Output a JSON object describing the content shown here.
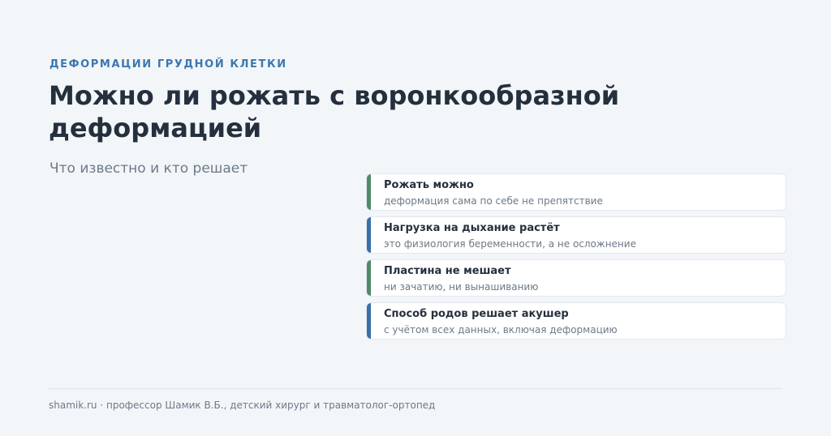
{
  "header": {
    "eyebrow": "ДЕФОРМАЦИИ ГРУДНОЙ КЛЕТКИ",
    "title": "Можно ли рожать с воронкообразной деформацией",
    "subtitle": "Что известно и кто решает"
  },
  "cards": [
    {
      "title": "Рожать можно",
      "subtitle": "деформация сама по себе не препятствие",
      "accent": "#4f8a68"
    },
    {
      "title": "Нагрузка на дыхание растёт",
      "subtitle": "это физиология беременности, а не осложнение",
      "accent": "#3a6fa8"
    },
    {
      "title": "Пластина не мешает",
      "subtitle": "ни зачатию, ни вынашиванию",
      "accent": "#4f8a68"
    },
    {
      "title": "Способ родов решает акушер",
      "subtitle": "с учётом всех данных, включая деформацию",
      "accent": "#3a6fa8"
    }
  ],
  "footer": {
    "text": "shamik.ru · профессор Шамик В.Б., детский хирург и травматолог-ортопед"
  },
  "colors": {
    "background": "#f3f6f9",
    "eyebrow": "#3a78b0",
    "title": "#24303d",
    "muted": "#6b7a88"
  }
}
